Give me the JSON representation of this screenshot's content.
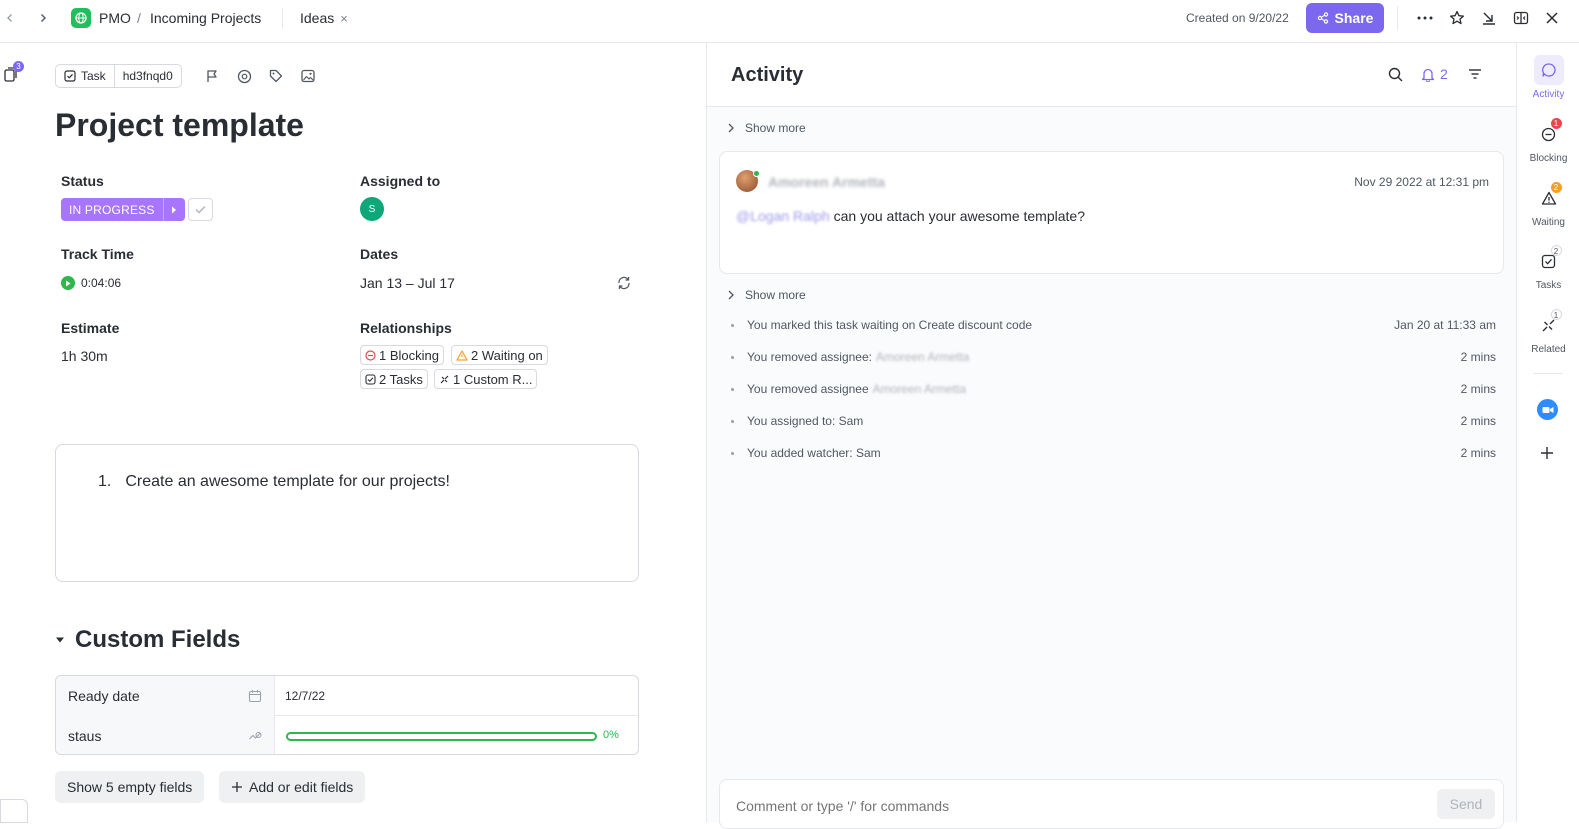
{
  "topbar": {
    "breadcrumb": [
      "PMO",
      "Incoming Projects"
    ],
    "breadcrumb_sep": "/",
    "tab_label": "Ideas",
    "tab_close": "×",
    "created": "Created on 9/20/22",
    "share_label": "Share"
  },
  "task": {
    "type_label": "Task",
    "id": "hd3fnqd0",
    "left_rail_badge": "3",
    "title": "Project template",
    "status_label": "Status",
    "status_value": "IN PROGRESS",
    "assigned_label": "Assigned to",
    "assignee_initial": "S",
    "track_time_label": "Track Time",
    "track_time_value": "0:04:06",
    "dates_label": "Dates",
    "dates_value": "Jan 13 – Jul 17",
    "estimate_label": "Estimate",
    "estimate_value": "1h 30m",
    "relationships_label": "Relationships",
    "relationships": {
      "blocking": "1 Blocking",
      "waiting": "2 Waiting on",
      "tasks": "2 Tasks",
      "custom": "1 Custom R..."
    },
    "description": {
      "number": "1.",
      "text": "Create an awesome template for our projects!"
    }
  },
  "custom_fields": {
    "title": "Custom Fields",
    "ready_date_label": "Ready date",
    "ready_date_value": "12/7/22",
    "staus_label": "staus",
    "staus_percent_text": "0%",
    "staus_progress": 0,
    "show_empty_label": "Show 5 empty fields",
    "add_edit_label": "Add or edit fields"
  },
  "activity": {
    "title": "Activity",
    "notif_count": "2",
    "show_more_1": "Show more",
    "show_more_2": "Show more",
    "comment": {
      "author": "Amoreen Armetta",
      "date": "Nov 29 2022 at 12:31 pm",
      "mention": "@Logan Ralph",
      "text": "can you attach your awesome template?"
    },
    "log": {
      "marked": {
        "text": "You marked this task waiting on Create discount code",
        "time": "Jan 20 at 11:33 am"
      },
      "removed_1": {
        "text": "You removed assignee:",
        "person": "Amoreen Armetta",
        "time": "2 mins"
      },
      "removed_2": {
        "text": "You removed assignee",
        "person": "Amoreen Armetta",
        "time": "2 mins"
      },
      "assigned": {
        "text": "You assigned to: Sam",
        "time": "2 mins"
      },
      "watcher": {
        "text": "You added watcher: Sam",
        "time": "2 mins"
      }
    },
    "comment_placeholder": "Comment or type '/' for commands",
    "send_label": "Send"
  },
  "rail": {
    "activity": {
      "label": "Activity"
    },
    "blocking": {
      "label": "Blocking",
      "badge": "1"
    },
    "waiting": {
      "label": "Waiting",
      "badge": "2"
    },
    "tasks": {
      "label": "Tasks",
      "badge": "2"
    },
    "related": {
      "label": "Related",
      "badge": "1"
    }
  },
  "colors": {
    "accent": "#7b68ee",
    "status": "#a875ff",
    "success": "#2cb84d",
    "danger": "#e5484d",
    "warning": "#f59f2b"
  }
}
